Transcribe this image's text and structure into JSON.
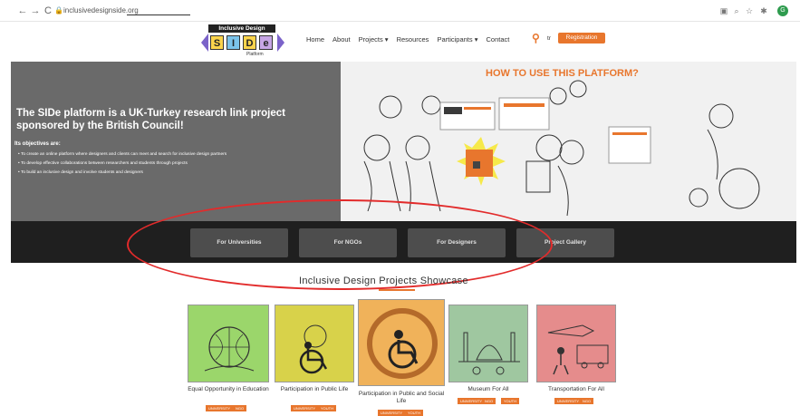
{
  "browser": {
    "url": "inclusivedesignside.org",
    "profile_initial": "G"
  },
  "header": {
    "logo_top": "Inclusive Design",
    "logo_letters": [
      "S",
      "I",
      "D",
      "e"
    ],
    "logo_sub": "Platform",
    "menu": [
      "Home",
      "About",
      "Projects ▾",
      "Resources",
      "Participants ▾",
      "Contact"
    ],
    "lang": "tr",
    "register_label": "Registration"
  },
  "hero": {
    "title": "The SIDe platform is a UK-Turkey research link project sponsored by the British Council!",
    "objectives_label": "Its objectives are:",
    "objectives": [
      "To create an online platform where designers and clients can meet and search for inclusive design partners",
      "To develop effective collaborations between researchers and students through projects",
      "To build an inclusive design and involve students and designers"
    ],
    "how_title": "HOW TO USE THIS PLATFORM?"
  },
  "band": {
    "buttons": [
      "For Universities",
      "For NGOs",
      "For Designers",
      "Project Gallery"
    ]
  },
  "showcase": {
    "title": "Inclusive Design Projects Showcase",
    "cards": [
      {
        "title": "Equal Opportunity in Education",
        "tags": [
          "UNIVERSITY",
          "NGO"
        ],
        "bg": "#9bd66b"
      },
      {
        "title": "Participation in Public Life",
        "tags": [
          "UNIVERSITY",
          "YOUTH"
        ],
        "bg": "#d8d24a"
      },
      {
        "title": "Participation in Public and Social Life",
        "tags": [
          "UNIVERSITY",
          "YOUTH"
        ],
        "bg": "#f0b25a"
      },
      {
        "title": "Museum For All",
        "tags": [
          "UNIVERSITY",
          "NGO",
          "YOUTH"
        ],
        "bg": "#9fc7a0"
      },
      {
        "title": "Transportation For All",
        "tags": [
          "UNIVERSITY",
          "NGO"
        ],
        "bg": "#e58c8c"
      }
    ]
  },
  "colors": {
    "accent": "#e8762d",
    "band": "#1f1f1f",
    "highlight": "#e22b2b"
  }
}
